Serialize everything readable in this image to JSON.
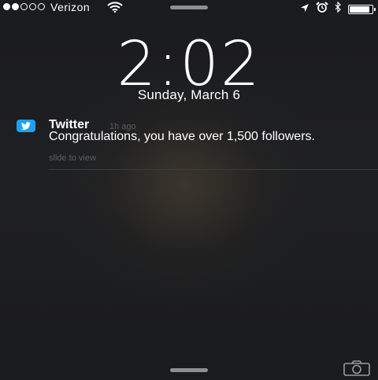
{
  "status_bar": {
    "carrier": "Verizon",
    "signal_bars_filled": 2,
    "signal_bars_total": 5,
    "icons": [
      "location-arrow-icon",
      "alarm-clock-icon",
      "bluetooth-icon",
      "battery-icon"
    ],
    "battery_level": 0.9
  },
  "lock_screen": {
    "time": "2:02",
    "date": "Sunday, March 6"
  },
  "notification": {
    "app": "Twitter",
    "time_ago": "1h ago",
    "message": "Congratulations, you have over 1,500 followers.",
    "hint": "slide to view",
    "app_icon": "twitter-bird-icon",
    "accent_color": "#1da1f2"
  },
  "footer": {
    "camera_icon": "camera-icon"
  }
}
